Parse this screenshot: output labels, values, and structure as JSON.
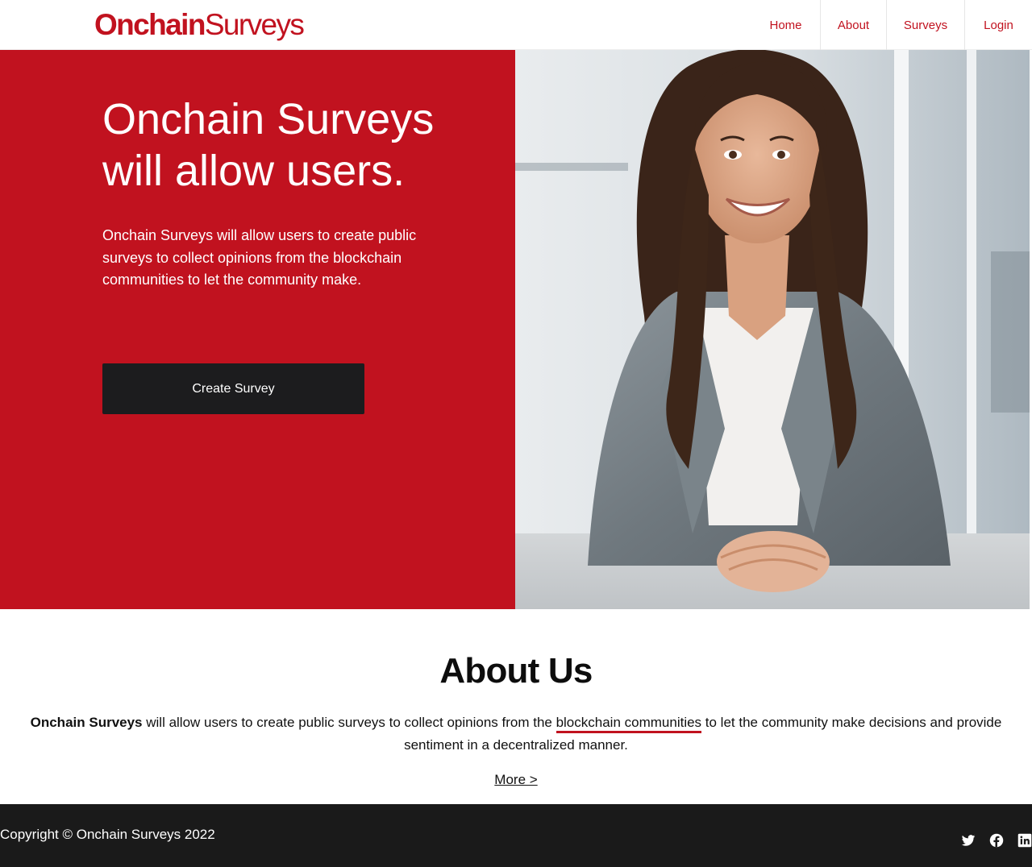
{
  "header": {
    "brand_bold": "Onchain",
    "brand_light": "Surveys",
    "nav": [
      "Home",
      "About",
      "Surveys",
      "Login"
    ]
  },
  "hero": {
    "title": "Onchain Surveys will allow users.",
    "text": "Onchain Surveys will allow users to create public surveys to collect opinions from the blockchain communities to let the community make.",
    "button": "Create Survey"
  },
  "about": {
    "title": "About Us",
    "lead_bold": "Onchain Surveys",
    "text_before_link": " will allow users to create public surveys to collect opinions from the ",
    "link": "blockchain communities",
    "text_after_link": " to let the community make decisions and provide sentiment in a decentralized manner.",
    "more": "More >"
  },
  "footer": {
    "copyright": "Copyright © Onchain Surveys 2022",
    "social_icons": [
      "twitter-icon",
      "facebook-icon",
      "linkedin-icon"
    ]
  },
  "colors": {
    "accent": "#c1121f",
    "dark": "#1c1c1e",
    "footer_bg": "#1a1a1a"
  }
}
